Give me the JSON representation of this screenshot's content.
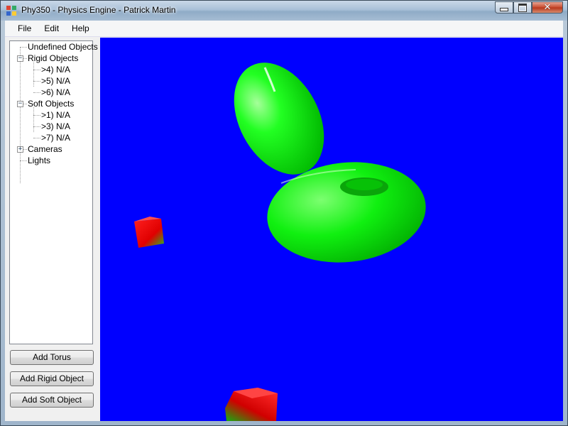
{
  "window": {
    "title": "Phy350 - Physics Engine - Patrick Martin",
    "close_glyph": "✕"
  },
  "menu": [
    "File",
    "Edit",
    "Help"
  ],
  "tree": {
    "expanders": {
      "collapse": "−",
      "expand": "+"
    },
    "undefined": "Undefined Objects",
    "rigid": {
      "label": "Rigid Objects",
      "children": [
        ">4) N/A",
        ">5) N/A",
        ">6) N/A"
      ]
    },
    "soft": {
      "label": "Soft Objects",
      "children": [
        ">1) N/A",
        ">3) N/A",
        ">7) N/A"
      ]
    },
    "cameras": "Cameras",
    "lights": "Lights"
  },
  "buttons": {
    "add_torus": "Add Torus",
    "add_rigid": "Add Rigid Object",
    "add_soft": "Add Soft Object"
  },
  "colors": {
    "viewport_bg": "#0000ff",
    "torus": "#00ff00",
    "cube_red": "#ff0000",
    "cube_green": "#00cc00"
  }
}
